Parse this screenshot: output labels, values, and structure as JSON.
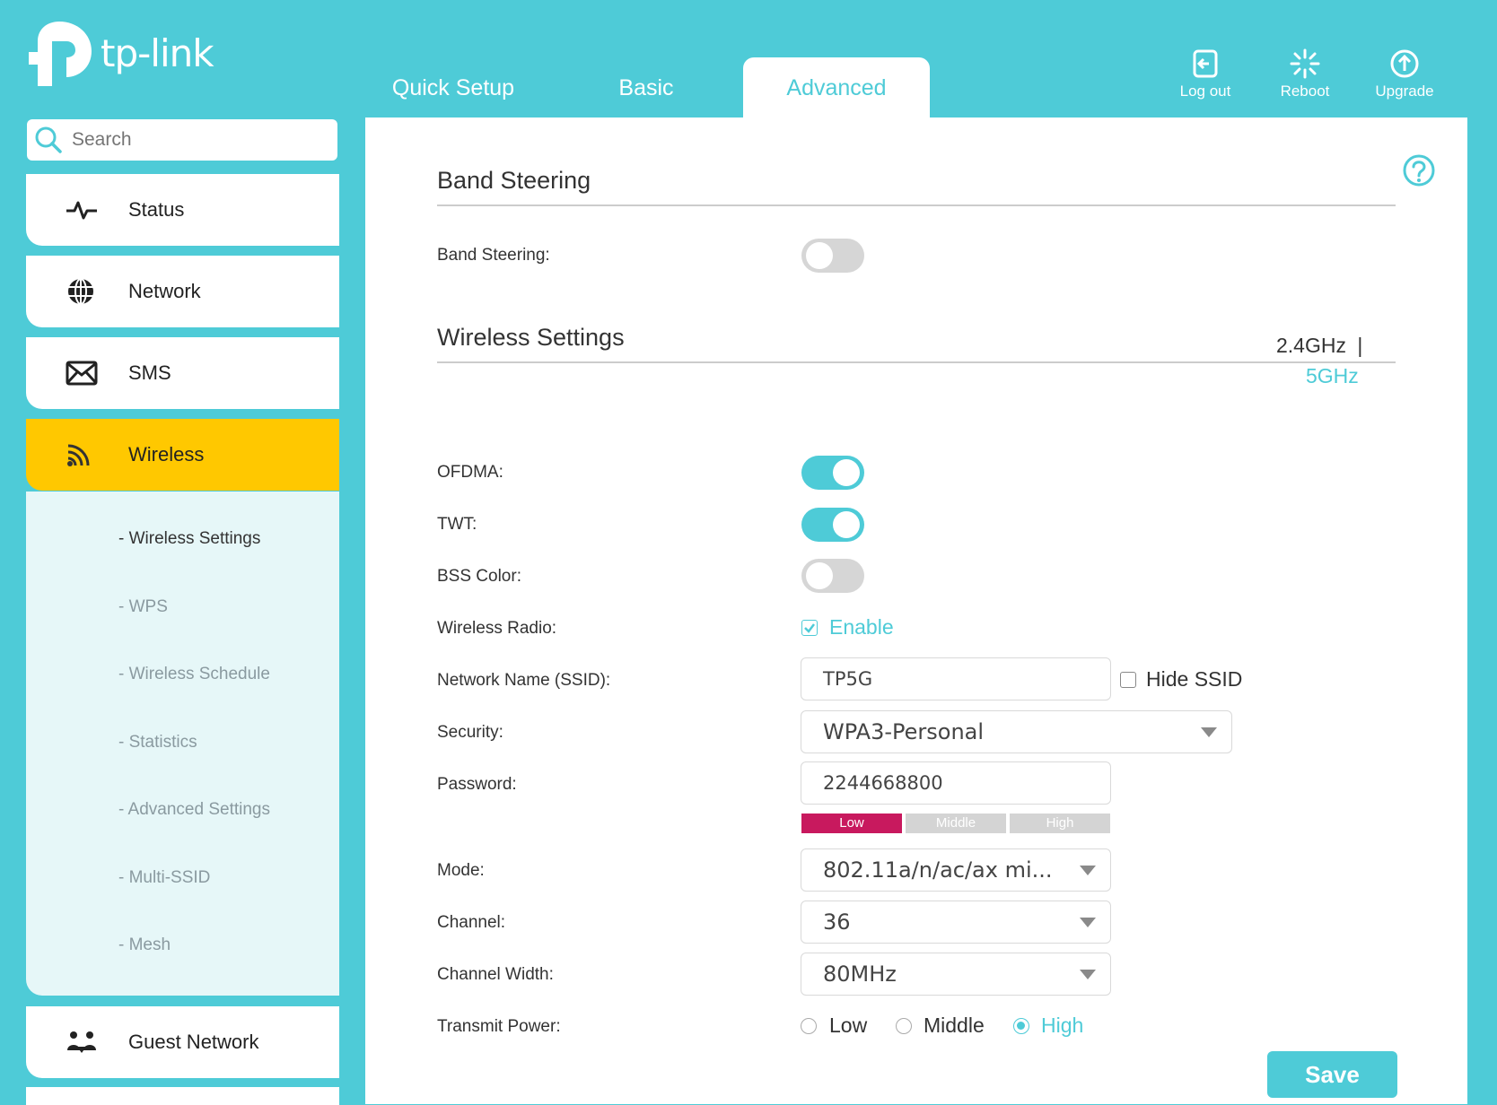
{
  "header": {
    "logo_text": "tp-link",
    "tabs": [
      {
        "label": "Quick Setup"
      },
      {
        "label": "Basic"
      },
      {
        "label": "Advanced"
      }
    ],
    "actions": {
      "logout": "Log out",
      "reboot": "Reboot",
      "upgrade": "Upgrade"
    }
  },
  "sidebar": {
    "search_placeholder": "Search",
    "items": [
      {
        "label": "Status",
        "icon": "pulse-icon"
      },
      {
        "label": "Network",
        "icon": "globe-icon"
      },
      {
        "label": "SMS",
        "icon": "envelope-icon"
      },
      {
        "label": "Wireless",
        "icon": "wifi-icon"
      },
      {
        "label": "Guest Network",
        "icon": "users-icon"
      }
    ],
    "submenu": [
      "- Wireless Settings",
      "- WPS",
      "- Wireless Schedule",
      "- Statistics",
      "- Advanced Settings",
      "- Multi-SSID",
      "- Mesh"
    ]
  },
  "main": {
    "band_steering": {
      "title": "Band Steering",
      "label": "Band Steering:",
      "enabled": false
    },
    "wireless": {
      "title": "Wireless Settings",
      "band_24": "2.4GHz",
      "band_sep": "|",
      "band_5": "5GHz",
      "ofdma_label": "OFDMA:",
      "twt_label": "TWT:",
      "bss_label": "BSS Color:",
      "radio_label": "Wireless Radio:",
      "radio_enable": "Enable",
      "ssid_label": "Network Name (SSID):",
      "ssid_value": "TP5G",
      "hide_ssid": "Hide SSID",
      "security_label": "Security:",
      "security_value": "WPA3-Personal",
      "password_label": "Password:",
      "password_value": "2244668800",
      "strength": [
        "Low",
        "Middle",
        "High"
      ],
      "mode_label": "Mode:",
      "mode_value": "802.11a/n/ac/ax mi...",
      "channel_label": "Channel:",
      "channel_value": "36",
      "width_label": "Channel Width:",
      "width_value": "80MHz",
      "power_label": "Transmit Power:",
      "power_options": [
        "Low",
        "Middle",
        "High"
      ],
      "power_selected": "High"
    },
    "save_label": "Save"
  },
  "colors": {
    "accent": "#4ecbd7",
    "active_nav": "#ffc800",
    "strength_low": "#c8195e"
  }
}
